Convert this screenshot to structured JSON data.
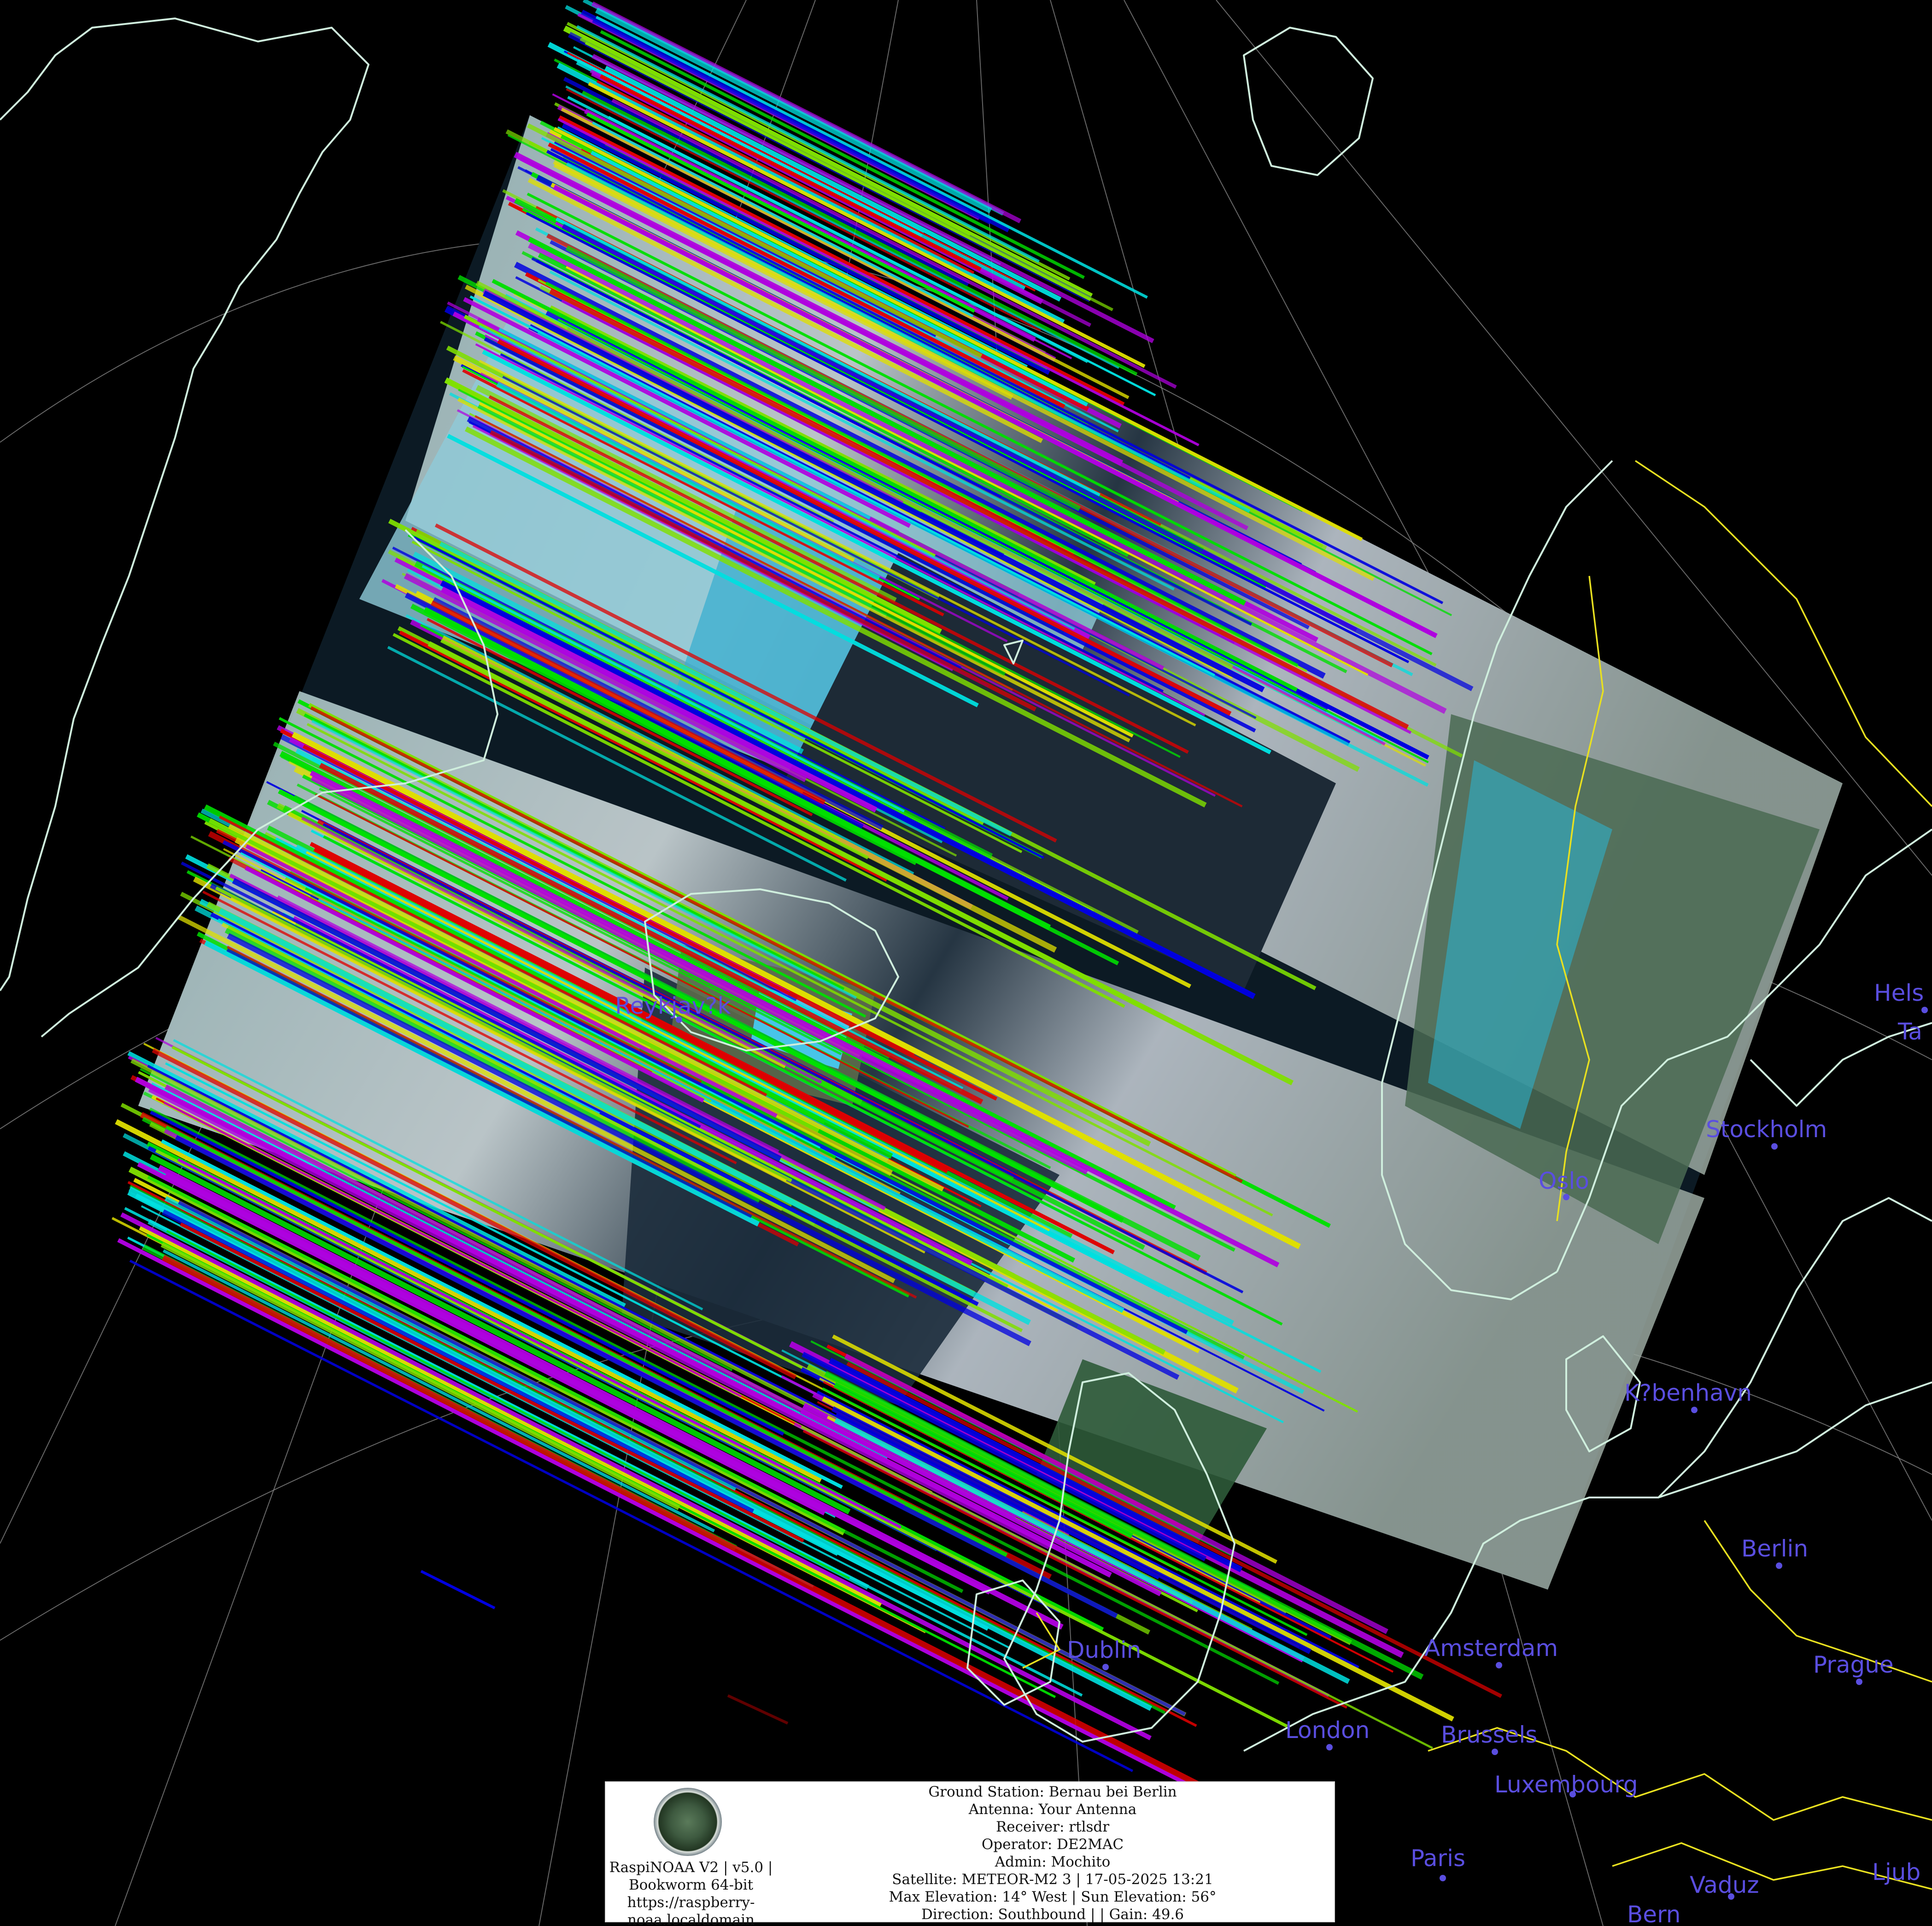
{
  "map": {
    "projection": "polar-stereographic",
    "cities": [
      {
        "name": "Reykjav?k"
      },
      {
        "name": "Oslo"
      },
      {
        "name": "Stockholm"
      },
      {
        "name": "Hels"
      },
      {
        "name": "Ta"
      },
      {
        "name": "K?benhavn"
      },
      {
        "name": "Berlin"
      },
      {
        "name": "Dublin"
      },
      {
        "name": "Amsterdam"
      },
      {
        "name": "Prague"
      },
      {
        "name": "London"
      },
      {
        "name": "Brussels"
      },
      {
        "name": "Luxembourg"
      },
      {
        "name": "Paris"
      },
      {
        "name": "Vaduz"
      },
      {
        "name": "Bern"
      },
      {
        "name": "Ljub"
      }
    ],
    "colors": {
      "background": "#000000",
      "coastline": "#cfeedd",
      "borders": "#e8e020",
      "graticule": "#8a8a8a",
      "city_label": "#5a4ee0"
    },
    "scan_artifact_colors": [
      "#00e000",
      "#0000e0",
      "#e00000",
      "#00e0e0",
      "#e0e000",
      "#b000e0",
      "#80e000"
    ]
  },
  "info": {
    "logo_caption": [
      "RaspiNOAA V2 | v5.0 |",
      "Bookworm 64-bit",
      "https://raspberry-",
      "noaa.localdomain"
    ],
    "lines": [
      "Ground Station: Bernau bei Berlin",
      "Antenna: Your Antenna",
      "Receiver: rtlsdr",
      "Operator: DE2MAC",
      "Admin: Mochito",
      "Satellite: METEOR-M2 3 | 17-05-2025 13:21",
      "Max Elevation: 14° West | Sun Elevation: 56°",
      "Direction: Southbound | | Gain: 49.6"
    ]
  }
}
